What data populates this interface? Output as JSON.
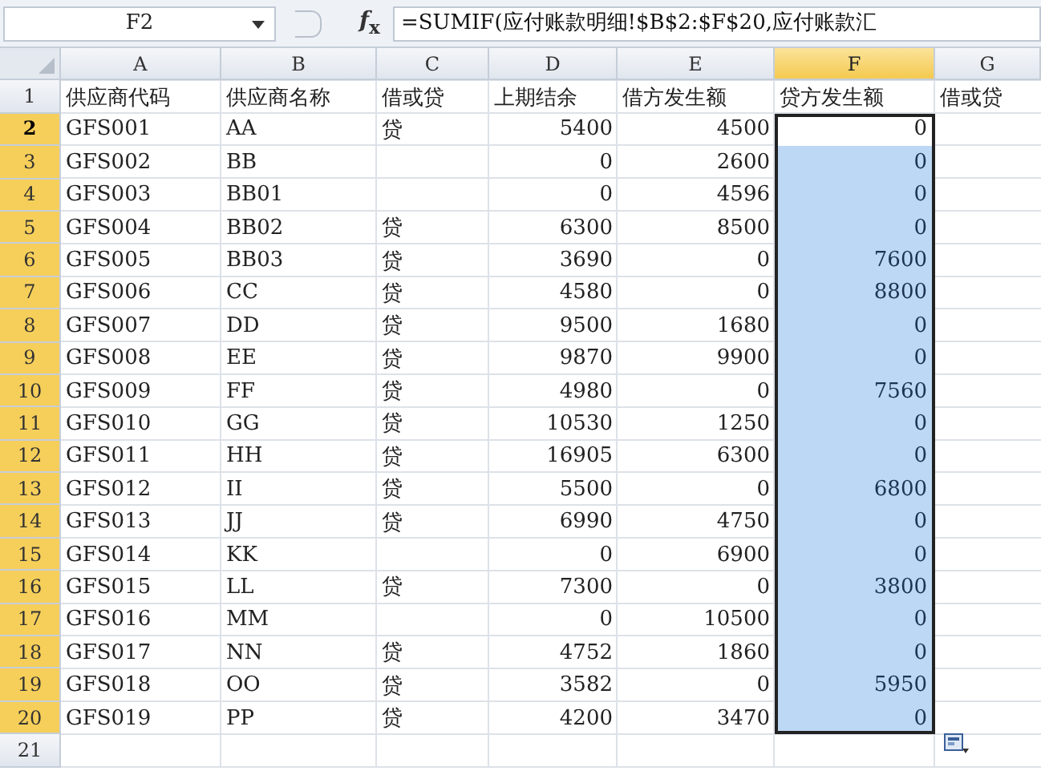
{
  "formula_bar": {
    "name_box": "F2",
    "function_button": "*f*$_{x}$",
    "formula": "=SUMIF(应付账款明细!$B$2:$F$20,应付账款汇"
  },
  "columns": [
    {
      "label": "A",
      "selected": false
    },
    {
      "label": "B",
      "selected": false
    },
    {
      "label": "C",
      "selected": false
    },
    {
      "label": "D",
      "selected": false
    },
    {
      "label": "E",
      "selected": false
    },
    {
      "label": "F",
      "selected": true
    },
    {
      "label": "G",
      "selected": false
    }
  ],
  "rows": [
    {
      "number": "1",
      "selected": false,
      "active": false,
      "cells": [
        "供应商代码",
        "供应商名称",
        "借或贷",
        "上期结余",
        "借方发生额",
        "贷方发生额",
        "借或贷"
      ]
    },
    {
      "number": "2",
      "selected": true,
      "active": true,
      "cells": [
        "GFS001",
        "AA",
        "贷",
        "5400",
        "4500",
        "0",
        null
      ]
    },
    {
      "number": "3",
      "selected": true,
      "active": false,
      "cells": [
        "GFS002",
        "BB",
        null,
        "0",
        "2600",
        "0",
        null
      ]
    },
    {
      "number": "4",
      "selected": true,
      "active": false,
      "cells": [
        "GFS003",
        "BB01",
        null,
        "0",
        "4596",
        "0",
        null
      ]
    },
    {
      "number": "5",
      "selected": true,
      "active": false,
      "cells": [
        "GFS004",
        "BB02",
        "贷",
        "6300",
        "8500",
        "0",
        null
      ]
    },
    {
      "number": "6",
      "selected": true,
      "active": false,
      "cells": [
        "GFS005",
        "BB03",
        "贷",
        "3690",
        "0",
        "7600",
        null
      ]
    },
    {
      "number": "7",
      "selected": true,
      "active": false,
      "cells": [
        "GFS006",
        "CC",
        "贷",
        "4580",
        "0",
        "8800",
        null
      ]
    },
    {
      "number": "8",
      "selected": true,
      "active": false,
      "cells": [
        "GFS007",
        "DD",
        "贷",
        "9500",
        "1680",
        "0",
        null
      ]
    },
    {
      "number": "9",
      "selected": true,
      "active": false,
      "cells": [
        "GFS008",
        "EE",
        "贷",
        "9870",
        "9900",
        "0",
        null
      ]
    },
    {
      "number": "10",
      "selected": true,
      "active": false,
      "cells": [
        "GFS009",
        "FF",
        "贷",
        "4980",
        "0",
        "7560",
        null
      ]
    },
    {
      "number": "11",
      "selected": true,
      "active": false,
      "cells": [
        "GFS010",
        "GG",
        "贷",
        "10530",
        "1250",
        "0",
        null
      ]
    },
    {
      "number": "12",
      "selected": true,
      "active": false,
      "cells": [
        "GFS011",
        "HH",
        "贷",
        "16905",
        "6300",
        "0",
        null
      ]
    },
    {
      "number": "13",
      "selected": true,
      "active": false,
      "cells": [
        "GFS012",
        "II",
        "贷",
        "5500",
        "0",
        "6800",
        null
      ]
    },
    {
      "number": "14",
      "selected": true,
      "active": false,
      "cells": [
        "GFS013",
        "JJ",
        "贷",
        "6990",
        "4750",
        "0",
        null
      ]
    },
    {
      "number": "15",
      "selected": true,
      "active": false,
      "cells": [
        "GFS014",
        "KK",
        null,
        "0",
        "6900",
        "0",
        null
      ]
    },
    {
      "number": "16",
      "selected": true,
      "active": false,
      "cells": [
        "GFS015",
        "LL",
        "贷",
        "7300",
        "0",
        "3800",
        null
      ]
    },
    {
      "number": "17",
      "selected": true,
      "active": false,
      "cells": [
        "GFS016",
        "MM",
        null,
        "0",
        "10500",
        "0",
        null
      ]
    },
    {
      "number": "18",
      "selected": true,
      "active": false,
      "cells": [
        "GFS017",
        "NN",
        "贷",
        "4752",
        "1860",
        "0",
        null
      ]
    },
    {
      "number": "19",
      "selected": true,
      "active": false,
      "cells": [
        "GFS018",
        "OO",
        "贷",
        "3582",
        "0",
        "5950",
        null
      ]
    },
    {
      "number": "20",
      "selected": true,
      "active": false,
      "cells": [
        "GFS019",
        "PP",
        "贷",
        "4200",
        "3470",
        "0",
        null
      ]
    },
    {
      "number": "21",
      "selected": false,
      "active": false,
      "cells": [
        null,
        null,
        null,
        null,
        null,
        null,
        null
      ]
    }
  ]
}
